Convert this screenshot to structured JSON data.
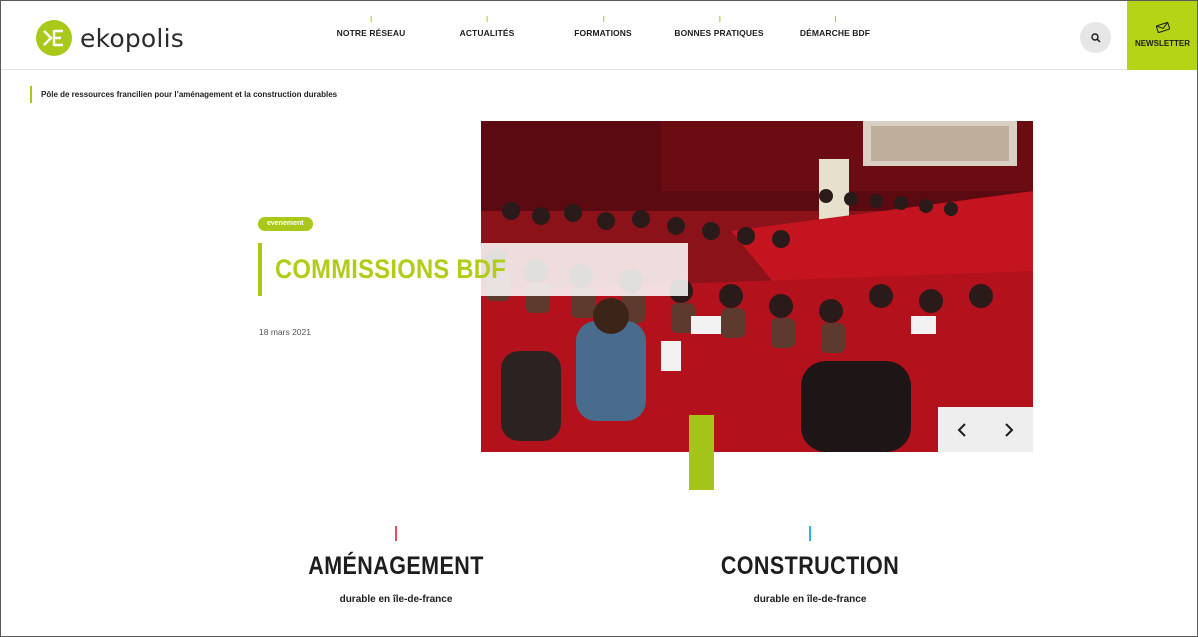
{
  "brand": {
    "name": "ekopolis",
    "accent": "#a8c81a"
  },
  "nav": {
    "items": [
      {
        "label": "NOTRE RÉSEAU"
      },
      {
        "label": "ACTUALITÉS"
      },
      {
        "label": "FORMATIONS"
      },
      {
        "label": "BONNES PRATIQUES"
      },
      {
        "label": "DÉMARCHE BDF"
      }
    ],
    "search_icon": "search-icon",
    "newsletter_label": "NEWSLETTER",
    "newsletter_icon": "envelope-icon"
  },
  "tagline": "Pôle de ressources francilien pour l’aménagement et la construction durables",
  "hero": {
    "badge": "evenement",
    "title": "COMMISSIONS BDF",
    "date": "18 mars 2021",
    "prev_icon": "chevron-left-icon",
    "next_icon": "chevron-right-icon"
  },
  "sections": [
    {
      "title": "AMÉNAGEMENT",
      "subtitle": "durable en île-de-france",
      "accent": "#e8505b"
    },
    {
      "title": "CONSTRUCTION",
      "subtitle": "durable en île-de-france",
      "accent": "#2bb5d8"
    }
  ]
}
